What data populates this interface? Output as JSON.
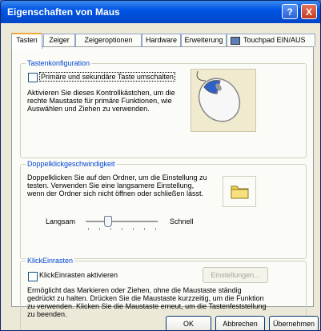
{
  "window": {
    "title": "Eigenschaften von Maus",
    "help_label": "?",
    "close_label": "X"
  },
  "tabs": [
    {
      "label": "Tasten"
    },
    {
      "label": "Zeiger"
    },
    {
      "label": "Zeigeroptionen"
    },
    {
      "label": "Hardware"
    },
    {
      "label": "Erweiterung"
    },
    {
      "label": "Touchpad EIN/AUS"
    }
  ],
  "tastenkonfiguration": {
    "legend": "Tastenkonfiguration",
    "checkbox_label": "Primäre und sekundäre Taste umschalten",
    "description": "Aktivieren Sie dieses Kontrollkästchen, um die rechte Maustaste für primäre Funktionen, wie Auswählen und Ziehen zu verwenden."
  },
  "doppelklick": {
    "legend": "Doppelklickgeschwindigkeit",
    "description": "Doppelklicken Sie auf den Ordner, um die Einstellung zu testen. Verwenden Sie eine langsamere Einstellung, wenn der Ordner sich nicht öffnen oder schließen lässt.",
    "slow_label": "Langsam",
    "fast_label": "Schnell",
    "speed_fraction": 0.3
  },
  "klickeinrasten": {
    "legend": "KlickEinrasten",
    "checkbox_label": "KlickEinrasten aktivieren",
    "settings_button": "Einstellungen...",
    "description": "Ermöglicht das Markieren oder Ziehen, ohne die Maustaste ständig gedrückt zu halten. Drücken Sie die Maustaste kurzzeitig, um die Funktion zu verwenden. Klicken Sie die Maustaste erneut, um die Tastenfeststellung zu beenden."
  },
  "footer": {
    "ok": "OK",
    "cancel": "Abbrechen",
    "apply": "Übernehmen"
  }
}
